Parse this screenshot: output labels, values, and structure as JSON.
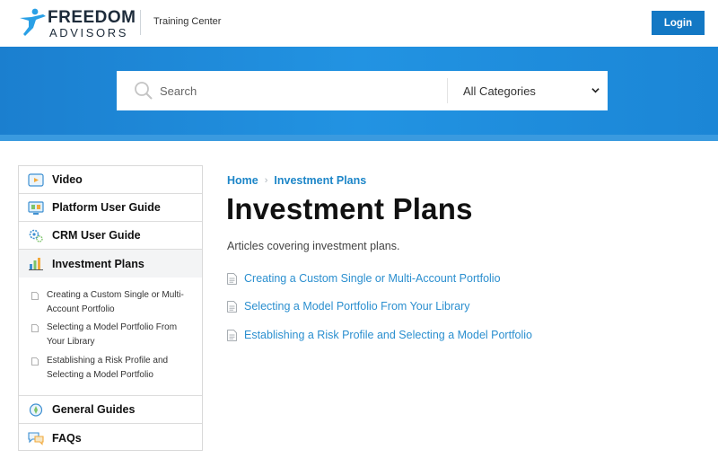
{
  "header": {
    "brand_line1": "FREEDOM",
    "brand_line2": "ADVISORS",
    "subtitle": "Training Center",
    "login_label": "Login",
    "accent_color": "#1378c4"
  },
  "search": {
    "placeholder": "Search",
    "category_selected": "All Categories",
    "icon": "search-icon"
  },
  "sidebar": {
    "items": [
      {
        "label": "Video",
        "icon": "video-icon"
      },
      {
        "label": "Platform User Guide",
        "icon": "platform-guide-icon"
      },
      {
        "label": "CRM User Guide",
        "icon": "crm-gear-icon"
      },
      {
        "label": "Investment Plans",
        "icon": "investment-chart-icon",
        "active": true
      },
      {
        "label": "General Guides",
        "icon": "general-guides-icon"
      },
      {
        "label": "FAQs",
        "icon": "faq-chat-icon"
      }
    ],
    "sub_items": [
      {
        "line1": "Creating a Custom Single or Multi-",
        "line2": "Account Portfolio"
      },
      {
        "line1": "Selecting a Model Portfolio From",
        "line2": "Your Library"
      },
      {
        "line1": "Establishing a Risk Profile and",
        "line2": "Selecting a Model Portfolio"
      }
    ]
  },
  "main": {
    "breadcrumb": {
      "home": "Home",
      "separator": "›",
      "current": "Investment Plans"
    },
    "title": "Investment Plans",
    "description": "Articles covering investment plans.",
    "articles": [
      "Creating a Custom Single or Multi-Account Portfolio",
      "Selecting a Model Portfolio From Your Library",
      "Establishing a Risk Profile and Selecting a Model Portfolio"
    ],
    "link_color": "#2b8fcf"
  }
}
